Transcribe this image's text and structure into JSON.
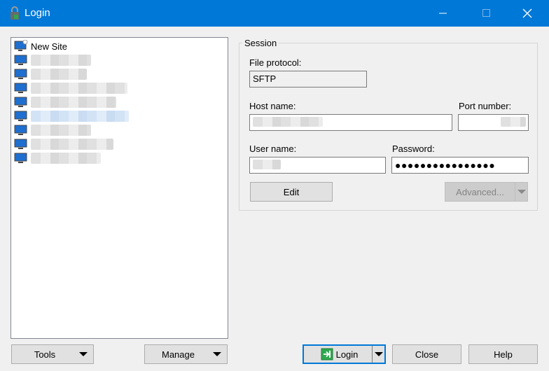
{
  "window": {
    "title": "Login",
    "accent": "#0078d7"
  },
  "tree": {
    "items": [
      {
        "label": "New Site",
        "icon": "new-site-icon"
      },
      {
        "label": "",
        "icon": "site-monitor-icon"
      },
      {
        "label": "",
        "icon": "site-monitor-icon"
      },
      {
        "label": "",
        "icon": "site-monitor-icon"
      },
      {
        "label": "",
        "icon": "site-monitor-icon"
      },
      {
        "label": "",
        "icon": "site-monitor-icon"
      },
      {
        "label": "",
        "icon": "site-monitor-icon"
      },
      {
        "label": "",
        "icon": "site-monitor-icon"
      },
      {
        "label": "",
        "icon": "site-monitor-icon"
      }
    ],
    "selected_index": 5
  },
  "session": {
    "legend": "Session",
    "file_protocol_label": "File protocol:",
    "file_protocol_value": "SFTP",
    "host_name_label": "Host name:",
    "host_name_value": "",
    "port_number_label": "Port number:",
    "port_number_value": "",
    "user_name_label": "User name:",
    "user_name_value": "",
    "password_label": "Password:",
    "password_value": "●●●●●●●●●●●●●●●●",
    "edit_button": "Edit",
    "advanced_button": "Advanced..."
  },
  "footer": {
    "tools_button": "Tools",
    "manage_button": "Manage",
    "login_button": "Login",
    "close_button": "Close",
    "help_button": "Help"
  }
}
